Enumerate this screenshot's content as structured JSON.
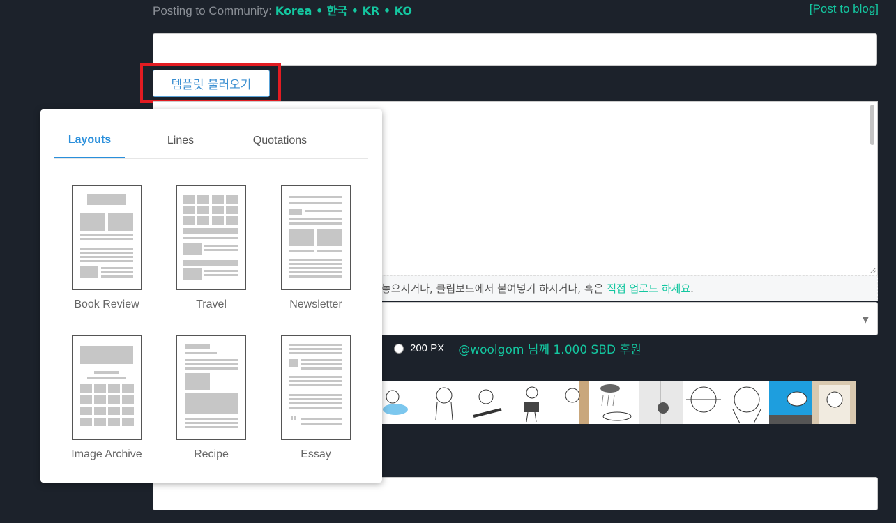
{
  "header": {
    "posting_label": "Posting to Community:",
    "community": "Korea • 한국 • KR • KO",
    "post_to_blog": "[Post to blog]"
  },
  "template_button_label": "템플릿 불러오기",
  "dropzone": {
    "text": "놓으시거나, 클립보드에서 붙여넣기 하시거나, 혹은 ",
    "link": "직접 업로드 하세요",
    "end": "."
  },
  "select": {
    "arrow_icon": "triangle-down-icon"
  },
  "size_option": {
    "label": "200 PX"
  },
  "tip_text": "@woolgom 님께 1.000 SBD 후원",
  "template_popup": {
    "tabs": [
      {
        "label": "Layouts",
        "active": true
      },
      {
        "label": "Lines",
        "active": false
      },
      {
        "label": "Quotations",
        "active": false
      }
    ],
    "layouts": [
      {
        "label": "Book Review"
      },
      {
        "label": "Travel"
      },
      {
        "label": "Newsletter"
      },
      {
        "label": "Image Archive"
      },
      {
        "label": "Recipe"
      },
      {
        "label": "Essay"
      }
    ]
  },
  "colors": {
    "background": "#1c222b",
    "accent": "#14c7a0",
    "tab_active": "#2a8fdb",
    "highlight": "#e21c22"
  }
}
